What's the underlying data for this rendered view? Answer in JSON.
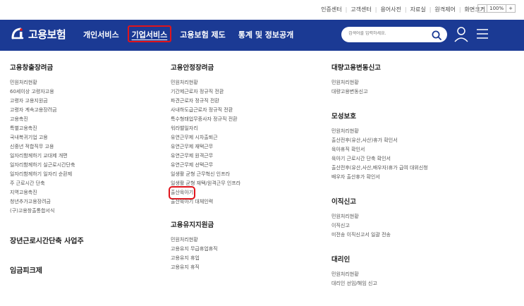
{
  "utility": {
    "links": [
      "인증센터",
      "고객센터",
      "용어사전",
      "자료실",
      "원격제어",
      "화면크기"
    ],
    "font_size": {
      "minus": "−",
      "value": "100%",
      "plus": "+"
    }
  },
  "header": {
    "logo_text": "고용보험",
    "nav": [
      "개인서비스",
      "기업서비스",
      "고용보험 제도",
      "통계 및 정보공개"
    ],
    "search_placeholder": "검색어를 입력하세요.",
    "accent": "#1b3a94",
    "highlight": "#e0141b"
  },
  "columns": [
    {
      "sections": [
        {
          "title": "고용창출장려금",
          "items": [
            "민원처리현황",
            "60세이상 고령자고용",
            "고령자 고용지원금",
            "고령자 계속고용장려금",
            "고용촉진",
            "특별고용촉진",
            "국내복귀기업 고용",
            "신중년 적합직무 고용",
            "일자리함께하기 교대제 개편",
            "일자리함께하기 실근로시간단축",
            "일자리함께하기 일자리 순환제",
            "주 근로시간 단축",
            "지역고용촉진",
            "청년추가고용장려금",
            "(구)고용창출통합서식"
          ]
        },
        {
          "title": "장년근로시간단축 사업주",
          "items": []
        },
        {
          "title": "임금피크제",
          "items": []
        }
      ]
    },
    {
      "sections": [
        {
          "title": "고용안정장려금",
          "items": [
            "민원처리현황",
            "기간제근로자 정규직 전환",
            "파견근로자 정규직 전환",
            "사내하도급근로자 정규직 전환",
            "특수형태업무종사자 정규직 전환",
            "워라밸일자리",
            "유연근무제 시차출퇴근",
            "유연근무제 재택근무",
            "유연근무제 원격근무",
            "유연근무제 선택근무",
            "일생활 균형 근무혁신 인프라",
            "일생활 균형 재택/원격근무 인프라",
            "출산육아기",
            "출산육아기 대체인력"
          ]
        },
        {
          "title": "고용유지지원금",
          "items": [
            "민원처리현황",
            "고용유지 무급휴업휴직",
            "고용유지 휴업",
            "고용유지 휴직"
          ]
        }
      ]
    },
    {
      "sections": [
        {
          "title": "대량고용변동신고",
          "items": [
            "민원처리현황",
            "대량고용변동신고"
          ]
        },
        {
          "title": "모성보호",
          "items": [
            "민원처리현황",
            "출산전후(유산,사산)휴가 확인서",
            "육아휴직 확인서",
            "육아기 근로시간 단축 확인서",
            "출산전후(유산,사산,배우자)휴가 급여 대위신청",
            "배우자 출산휴가 확인서"
          ]
        },
        {
          "title": "이직신고",
          "items": [
            "민원처리현황",
            "이직신고",
            "미전송 이직신고서 일괄 전송"
          ]
        },
        {
          "title": "대리인",
          "items": [
            "민원처리현황",
            "대리인 선임/해임 신고"
          ]
        }
      ]
    }
  ]
}
